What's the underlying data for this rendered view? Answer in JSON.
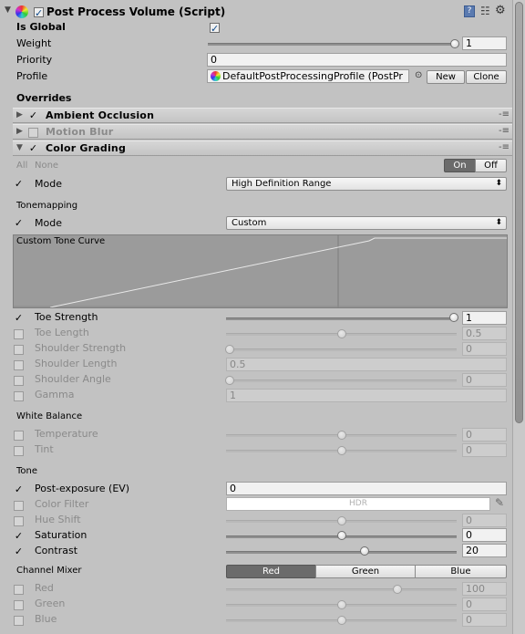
{
  "component": {
    "title": "Post Process Volume (Script)",
    "is_global_label": "Is Global",
    "weight_label": "Weight",
    "weight_value": "1",
    "weight_fraction": 1,
    "priority_label": "Priority",
    "priority_value": "0",
    "profile_label": "Profile",
    "profile_value": "DefaultPostProcessingProfile (PostPr",
    "new_label": "New",
    "clone_label": "Clone",
    "overrides_label": "Overrides"
  },
  "effects": [
    {
      "label": "Ambient Occlusion",
      "enabled": true,
      "expanded": false
    },
    {
      "label": "Motion Blur",
      "enabled": false,
      "expanded": false
    },
    {
      "label": "Color Grading",
      "enabled": true,
      "expanded": true
    }
  ],
  "color_grading": {
    "all_label": "All",
    "none_label": "None",
    "on_label": "On",
    "off_label": "Off",
    "mode_label": "Mode",
    "mode_value": "High Definition Range",
    "tonemapping_section": "Tonemapping",
    "tonemap_mode_label": "Mode",
    "tonemap_mode_value": "Custom",
    "curve_label": "Custom Tone Curve",
    "toe_strength_label": "Toe Strength",
    "toe_strength_value": "1",
    "toe_length_label": "Toe Length",
    "toe_length_value": "0.5",
    "shoulder_strength_label": "Shoulder Strength",
    "shoulder_strength_value": "0",
    "shoulder_length_label": "Shoulder Length",
    "shoulder_length_value": "0.5",
    "shoulder_angle_label": "Shoulder Angle",
    "shoulder_angle_value": "0",
    "gamma_label": "Gamma",
    "gamma_value": "1",
    "white_balance_section": "White Balance",
    "temperature_label": "Temperature",
    "temperature_value": "0",
    "tint_label": "Tint",
    "tint_value": "0",
    "tone_section": "Tone",
    "post_exposure_label": "Post-exposure (EV)",
    "post_exposure_value": "0",
    "color_filter_label": "Color Filter",
    "color_filter_value": "HDR",
    "hue_shift_label": "Hue Shift",
    "hue_shift_value": "0",
    "saturation_label": "Saturation",
    "saturation_value": "0",
    "contrast_label": "Contrast",
    "contrast_value": "20",
    "channel_mixer_section": "Channel Mixer",
    "red_tab": "Red",
    "green_tab": "Green",
    "blue_tab": "Blue",
    "red_label": "Red",
    "red_value": "100",
    "green_label": "Green",
    "green_value": "0",
    "blue_label": "Blue",
    "blue_value": "0"
  },
  "icons": {
    "help": "help-icon",
    "settings": "gear-icon",
    "menu": "context-menu-icon"
  }
}
